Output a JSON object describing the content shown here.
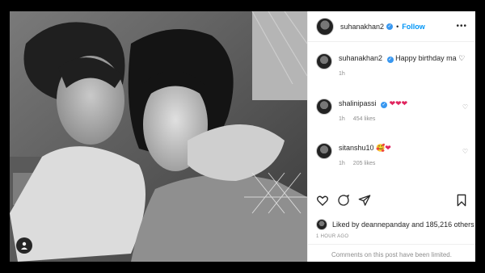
{
  "post": {
    "username": "suhanakhan2",
    "follow_label": "Follow",
    "separator": "•",
    "caption": "Happy birthday ma",
    "caption_time": "1h",
    "likes_text": "Liked by deannepanday and 185,216 others",
    "date_label": "1 HOUR AGO",
    "comments_limited": "Comments on this post have been limited."
  },
  "comments": [
    {
      "username": "shalinipassi",
      "text": "❤❤❤",
      "time": "1h",
      "likes": "454 likes"
    },
    {
      "username": "sitanshu10",
      "text": "🥰❤",
      "time": "1h",
      "likes": "205 likes"
    }
  ],
  "icons": {
    "verified": "verified-badge-icon",
    "more": "more-options-icon",
    "heart": "heart-icon",
    "comment": "comment-icon",
    "share": "share-icon",
    "save": "bookmark-icon",
    "user_tag": "user-tag-icon"
  },
  "colors": {
    "accent": "#0095f6",
    "verified": "#3897f0",
    "heart_red": "#e0245e",
    "muted": "#8e8e8e"
  }
}
